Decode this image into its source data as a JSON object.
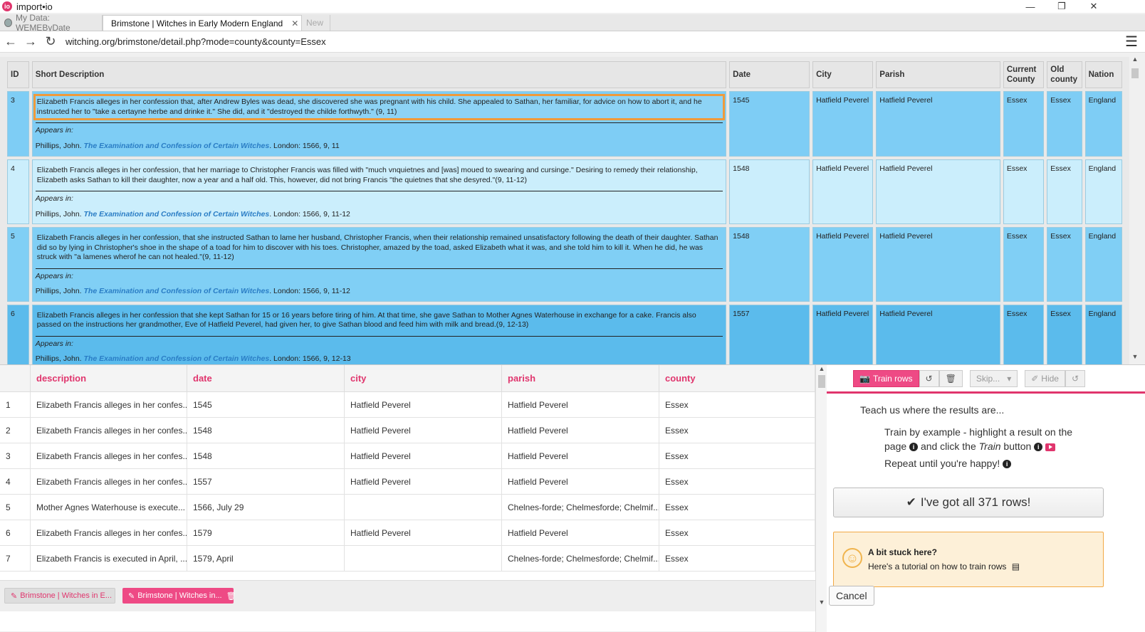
{
  "app": {
    "title": "import•io",
    "logo_text": "io"
  },
  "window_controls": {
    "minimize": "—",
    "restore": "❐",
    "close": "✕"
  },
  "browser_tabs": [
    {
      "label": "My Data: WEMEByDate"
    },
    {
      "label": "Brimstone | Witches in Early Modern England",
      "close": "✕"
    },
    {
      "label": "New"
    }
  ],
  "nav": {
    "back": "←",
    "forward": "→",
    "reload": "↻",
    "menu": "☰",
    "url": "witching.org/brimstone/detail.php?mode=county&county=Essex"
  },
  "webtable": {
    "headers": {
      "id": "ID",
      "desc": "Short Description",
      "date": "Date",
      "city": "City",
      "parish": "Parish",
      "current_county": "Current County",
      "old_county": "Old county",
      "nation": "Nation"
    },
    "appears_label": "Appears in:",
    "rows": [
      {
        "id": "3",
        "desc": "Elizabeth Francis alleges in her confession that, after Andrew Byles was dead, she discovered she was pregnant with his child. She appealed to Sathan, her familiar, for advice on how to abort it, and he instructed her to \"take a certayne herbe and drinke it.\" She did, and it \"destroyed the childe forthwyth.\" (9, 11)",
        "cite_author": "Phillips, John.",
        "cite_title": "The Examination and Confession of Certain Witches",
        "cite_rest": ". London: 1566, 9, 11",
        "date": "1545",
        "city": "Hatfield Peverel",
        "parish": "Hatfield Peverel",
        "current_county": "Essex",
        "old_county": "Essex",
        "nation": "England"
      },
      {
        "id": "4",
        "desc": "Elizabeth Francis alleges in her confession, that her marriage to Christopher Francis was filled with \"much vnquietnes and [was] moued to swearing and cursinge.\" Desiring to remedy their relationship, Elizabeth asks Sathan to kill their daughter, now a year and a half old. This, however, did not bring Francis \"the quietnes that she desyred.\"(9, 11-12)",
        "cite_author": "Phillips, John.",
        "cite_title": "The Examination and Confession of Certain Witches",
        "cite_rest": ". London: 1566, 9, 11-12",
        "date": "1548",
        "city": "Hatfield Peverel",
        "parish": "Hatfield Peverel",
        "current_county": "Essex",
        "old_county": "Essex",
        "nation": "England"
      },
      {
        "id": "5",
        "desc": "Elizabeth Francis alleges in her confession, that she instructed Sathan to lame her husband, Christopher Francis, when their relationship remained unsatisfactory following the death of their daughter. Sathan did so by lying in Christopher's shoe in the shape of a toad for him to discover with his toes. Christopher, amazed by the toad, asked Elizabeth what it was, and she told him to kill it. When he did, he was struck with \"a lamenes wherof he can not healed.\"(9, 11-12)",
        "cite_author": "Phillips, John.",
        "cite_title": "The Examination and Confession of Certain Witches",
        "cite_rest": ". London: 1566, 9, 11-12",
        "date": "1548",
        "city": "Hatfield Peverel",
        "parish": "Hatfield Peverel",
        "current_county": "Essex",
        "old_county": "Essex",
        "nation": "England"
      },
      {
        "id": "6",
        "desc": "Elizabeth Francis alleges in her confession that she kept Sathan for 15 or 16 years before tiring of him. At that time, she gave Sathan to Mother Agnes Waterhouse in exchange for a cake. Francis also passed on the instructions her grandmother, Eve of Hatfield Peverel, had given her, to give Sathan blood and feed him with milk and bread.(9, 12-13)",
        "cite_author": "Phillips, John.",
        "cite_title": "The Examination and Confession of Certain Witches",
        "cite_rest": ". London: 1566, 9, 12-13",
        "date": "1557",
        "city": "Hatfield Peverel",
        "parish": "Hatfield Peverel",
        "current_county": "Essex",
        "old_county": "Essex",
        "nation": "England"
      }
    ]
  },
  "grid": {
    "columns": [
      "description",
      "date",
      "city",
      "parish",
      "county"
    ],
    "rows": [
      [
        "1",
        "Elizabeth Francis alleges in her confes...",
        "1545",
        "Hatfield Peverel",
        "Hatfield Peverel",
        "Essex"
      ],
      [
        "2",
        "Elizabeth Francis alleges in her confes...",
        "1548",
        "Hatfield Peverel",
        "Hatfield Peverel",
        "Essex"
      ],
      [
        "3",
        "Elizabeth Francis alleges in her confes...",
        "1548",
        "Hatfield Peverel",
        "Hatfield Peverel",
        "Essex"
      ],
      [
        "4",
        "Elizabeth Francis alleges in her confes...",
        "1557",
        "Hatfield Peverel",
        "Hatfield Peverel",
        "Essex"
      ],
      [
        "5",
        "Mother Agnes Waterhouse is execute...",
        "1566, July 29",
        "",
        "Chelnes-forde; Chelmesforde; Chelmif...",
        "Essex"
      ],
      [
        "6",
        "Elizabeth Francis alleges in her confes...",
        "1579",
        "Hatfield Peverel",
        "Hatfield Peverel",
        "Essex"
      ],
      [
        "7",
        "Elizabeth Francis is executed in April, ...",
        "1579, April",
        "",
        "Chelnes-forde; Chelmesforde; Chelmif...",
        "Essex"
      ]
    ]
  },
  "source_tabs": [
    {
      "label": "Brimstone | Witches in E..."
    },
    {
      "label": "Brimstone | Witches in..."
    }
  ],
  "panel": {
    "train_label": "Train rows",
    "skip_label": "Skip...",
    "hide_label": "Hide",
    "teach": "Teach us where the results are...",
    "tip1_a": "Train by example - highlight a result on the page",
    "tip1_b": "and click the",
    "tip1_train": "Train",
    "tip1_c": "button",
    "tip2": "Repeat until you're happy!",
    "got_all": "I've got all 371 rows!",
    "stuck_title": "A bit stuck here?",
    "stuck_link": "Here's a tutorial on how to train rows",
    "cancel": "Cancel"
  },
  "colors": {
    "accent": "#e0356d",
    "row_selected": "#7ecdf5",
    "highlight": "#f09a3a"
  }
}
